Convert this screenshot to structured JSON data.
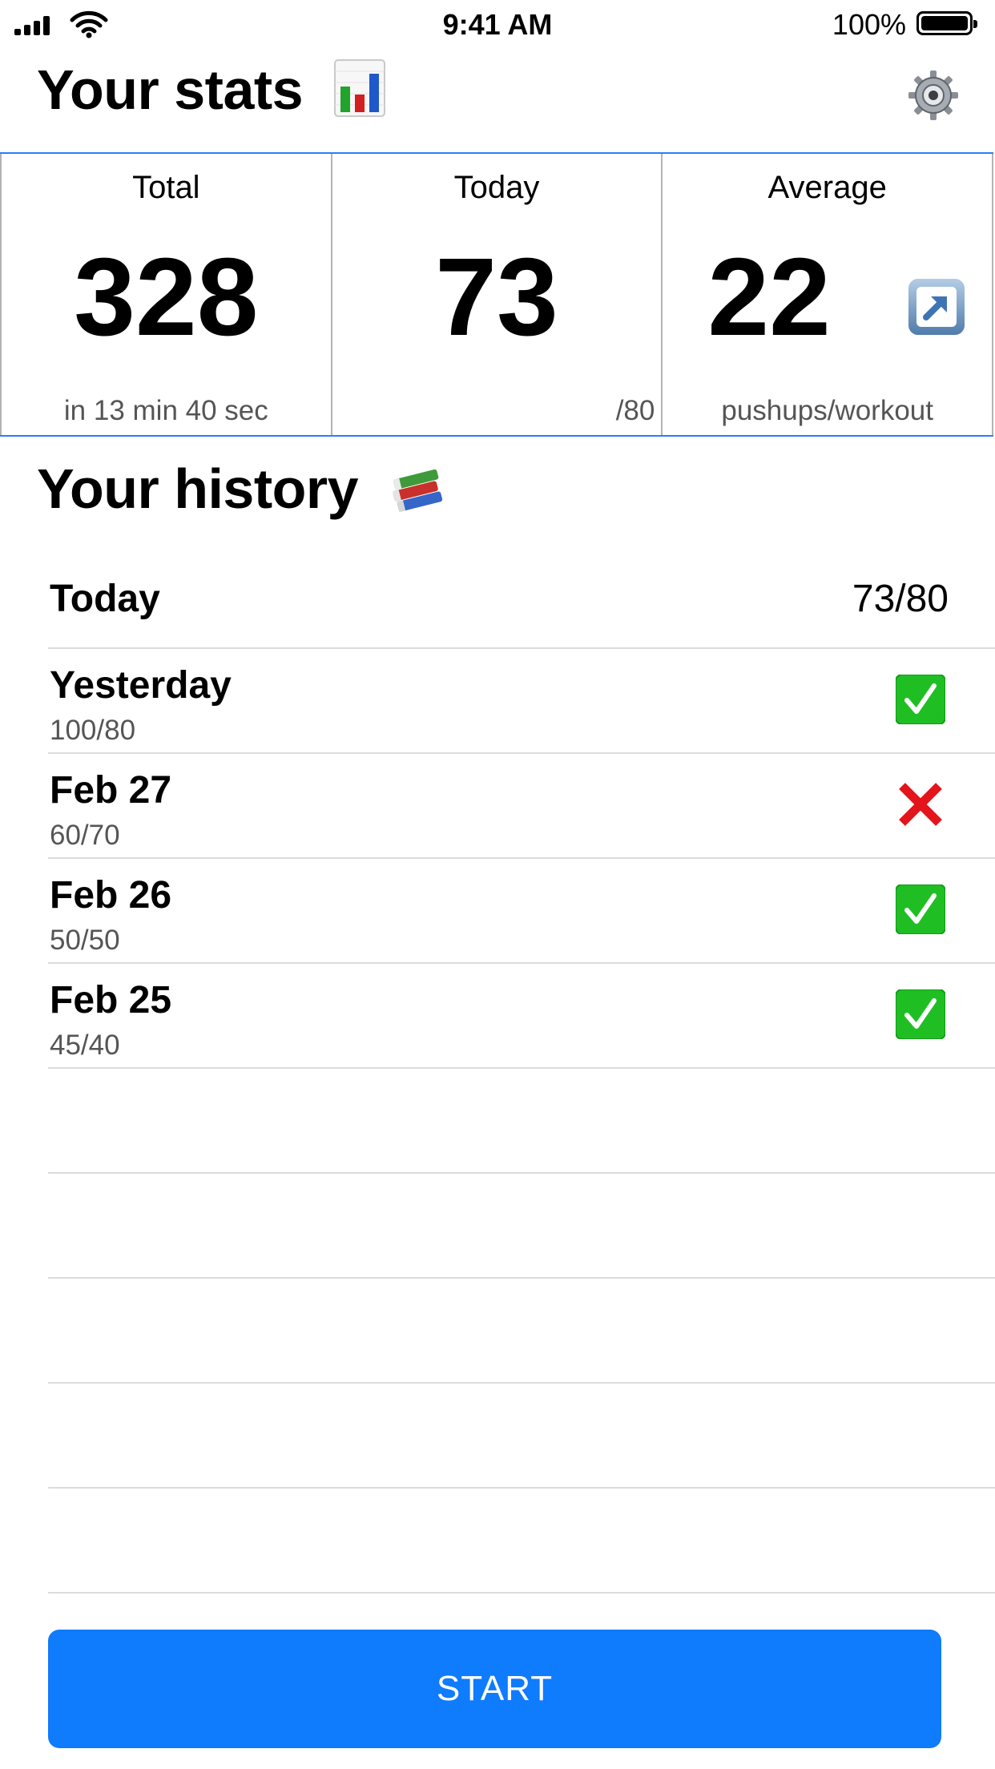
{
  "status_bar": {
    "time": "9:41 AM",
    "battery_percent": "100%"
  },
  "header": {
    "title": "Your stats",
    "title_icon": "bar-chart-icon",
    "settings_icon": "gear-icon"
  },
  "stats": {
    "total": {
      "label": "Total",
      "value": "328",
      "sub": "in 13 min 40 sec"
    },
    "today": {
      "label": "Today",
      "value": "73",
      "sub": "/80"
    },
    "average": {
      "label": "Average",
      "value": "22",
      "sub": "pushups/workout",
      "action_icon": "up-right-arrow-icon"
    }
  },
  "history": {
    "title": "Your history",
    "title_icon": "books-icon",
    "today": {
      "date": "Today",
      "score": "73/80"
    },
    "items": [
      {
        "date": "Yesterday",
        "score": "100/80",
        "status": "check-mark-icon"
      },
      {
        "date": "Feb 27",
        "score": "60/70",
        "status": "cross-mark-icon"
      },
      {
        "date": "Feb 26",
        "score": "50/50",
        "status": "check-mark-icon"
      },
      {
        "date": "Feb 25",
        "score": "45/40",
        "status": "check-mark-icon"
      }
    ]
  },
  "start_button": {
    "label": "START"
  },
  "colors": {
    "accent": "#0f7bfd",
    "divider": "#dcdcdc",
    "check_green": "#1fbf24",
    "cross_red": "#e3141b"
  }
}
